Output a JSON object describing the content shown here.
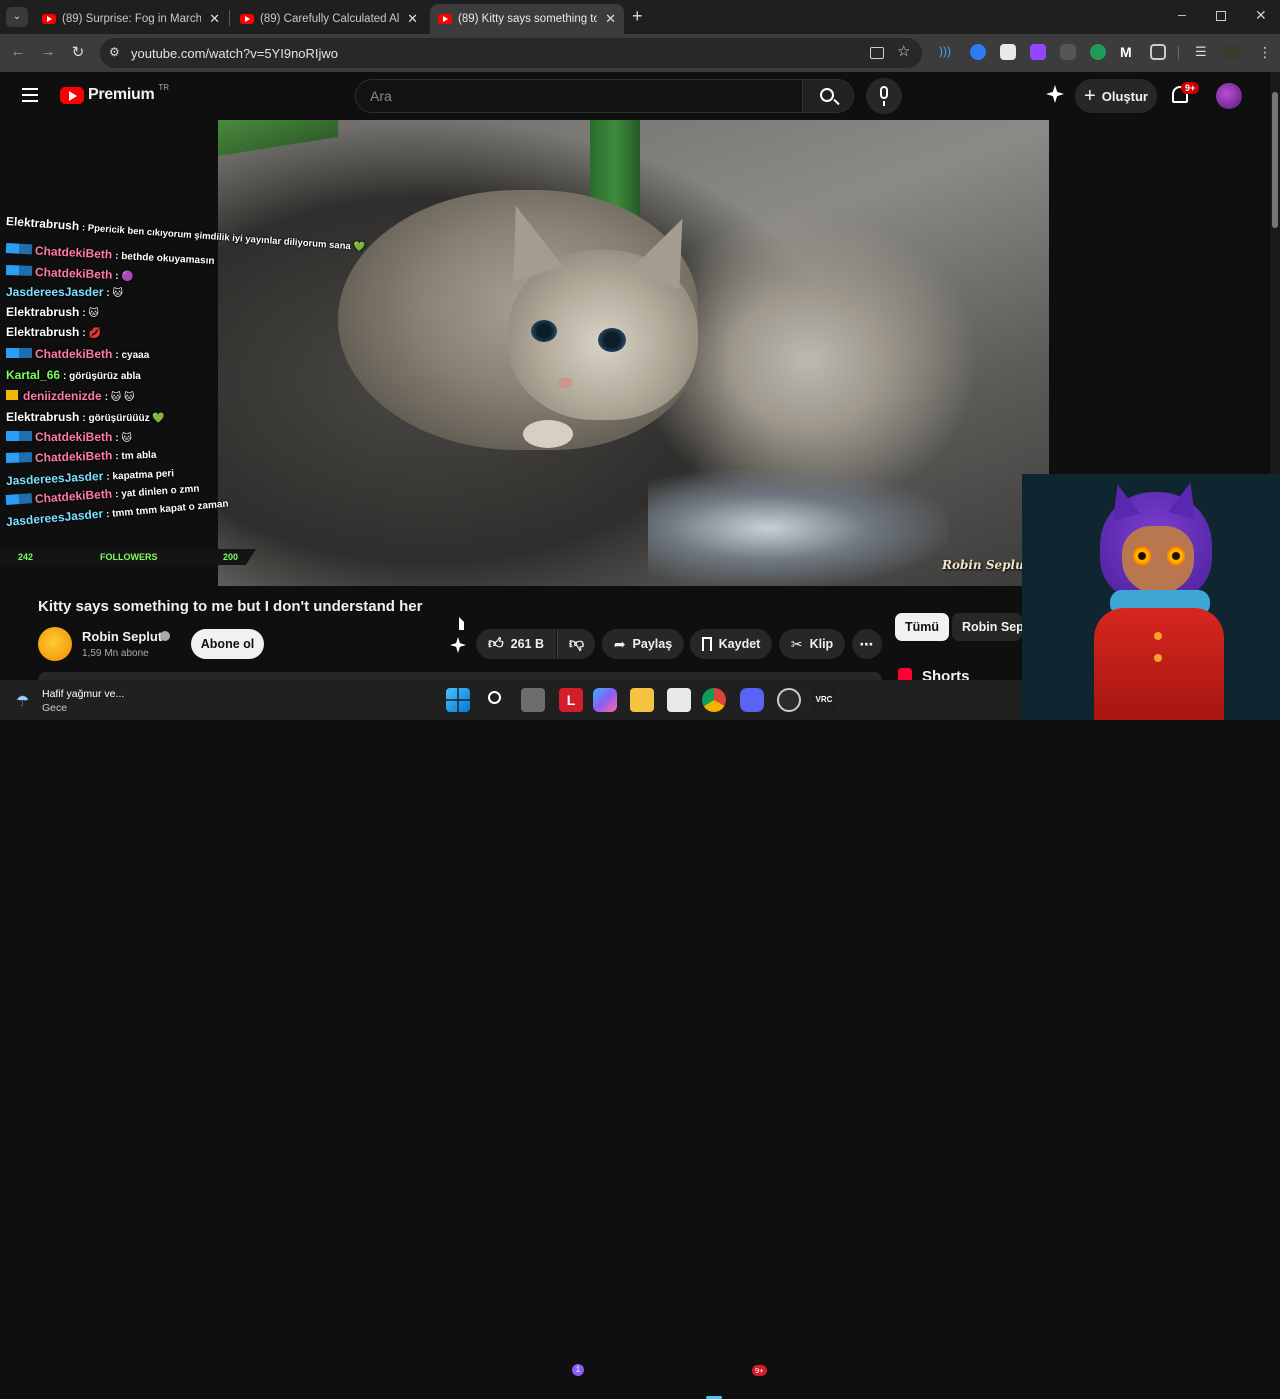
{
  "browser": {
    "tabs": [
      {
        "title": "(89) Surprise: Fog in March. Lo..."
      },
      {
        "title": "(89) Carefully Calculated All The..."
      },
      {
        "title": "(89) Kitty says something to me..."
      }
    ],
    "url": "youtube.com/watch?v=5YI9noRIjwo"
  },
  "yt": {
    "logo_text": "Premium",
    "logo_region": "TR",
    "search_placeholder": "Ara",
    "create_label": "Oluştur",
    "notif_badge": "9+"
  },
  "overlay": {
    "chat": [
      {
        "name": "Elektrabrush",
        "color": "#ffffff",
        "badge": false,
        "msg": ": Ppericik ben cıkıyorum şimdilik iyi yayınlar diliyorum sana 💚"
      },
      {
        "name": "ChatdekiBeth",
        "color": "#ff7aa8",
        "badge": true,
        "msg": ": bethde okuyamasın"
      },
      {
        "name": "ChatdekiBeth",
        "color": "#ff7aa8",
        "badge": true,
        "msg": ": 🟣"
      },
      {
        "name": "JasdereesJasder",
        "color": "#7ee0ff",
        "badge": false,
        "msg": ": 🐱"
      },
      {
        "name": "Elektrabrush",
        "color": "#ffffff",
        "badge": false,
        "msg": ": 🐱"
      },
      {
        "name": "Elektrabrush",
        "color": "#ffffff",
        "badge": false,
        "msg": ": 💋"
      },
      {
        "name": "ChatdekiBeth",
        "color": "#ff7aa8",
        "badge": true,
        "msg": ": cyaaa"
      },
      {
        "name": "Kartal_66",
        "color": "#7cff5a",
        "badge": false,
        "msg": ": görüşürüz abla"
      },
      {
        "name": "deniizdenizde",
        "color": "#ff7aa8",
        "badge": false,
        "msg": ": 🐱 🐱"
      },
      {
        "name": "Elektrabrush",
        "color": "#ffffff",
        "badge": false,
        "msg": ": görüşürüüüz 💚"
      },
      {
        "name": "ChatdekiBeth",
        "color": "#ff7aa8",
        "badge": true,
        "msg": ": 🐱"
      },
      {
        "name": "ChatdekiBeth",
        "color": "#ff7aa8",
        "badge": true,
        "msg": ": tm abla"
      },
      {
        "name": "JasdereesJasder",
        "color": "#7ee0ff",
        "badge": false,
        "msg": ": kapatma peri"
      },
      {
        "name": "ChatdekiBeth",
        "color": "#ff7aa8",
        "badge": true,
        "msg": ": yat dinlen o zmn"
      },
      {
        "name": "JasdereesJasder",
        "color": "#7ee0ff",
        "badge": false,
        "msg": ": tmm tmm kapat o zaman"
      }
    ],
    "follow_current": "242",
    "follow_label": "FOLLOWERS",
    "follow_goal": "200"
  },
  "video": {
    "watermark": "Robin Seplut",
    "title": "Kitty says something to me but I don't understand her",
    "channel": "Robin Seplut",
    "subs": "1,59 Mn abone",
    "subscribe_label": "Abone ol",
    "likes": "261 B",
    "share_label": "Paylaş",
    "save_label": "Kaydet",
    "clip_label": "Klip"
  },
  "sidebar": {
    "chips": [
      "Tümü",
      "Robin Seplut"
    ],
    "shorts_label": "Shorts"
  },
  "taskbar": {
    "weather_title": "Hafif yağmur ve...",
    "weather_sub": "Gece",
    "discord_badge": "9+",
    "mail_badge": "1"
  }
}
